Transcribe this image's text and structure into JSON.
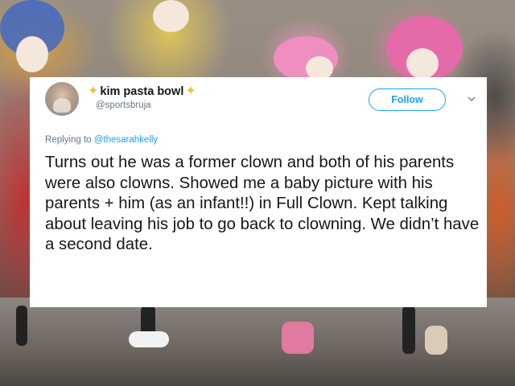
{
  "tweet": {
    "sparkle_left": "✦",
    "display_name": "kim pasta bowl",
    "sparkle_right": "✦",
    "handle": "@sportsbruja",
    "follow_label": "Follow",
    "reply_prefix": "Replying to",
    "reply_mention": "@thesarahkelly",
    "body": "Turns out he was a former clown and both of his parents were also clowns. Showed me a baby picture with his parents + him (as an infant!!) in Full Clown. Kept talking about leaving his job to go back to clowning. We didn’t have a second date."
  },
  "icons": {
    "caret": "chevron-down-icon",
    "sparkle": "sparkle-icon"
  },
  "colors": {
    "accent": "#1da1f2",
    "sparkle": "#f1c232",
    "text_primary": "#14171a",
    "text_secondary": "#657786",
    "card_bg": "#ffffff"
  }
}
